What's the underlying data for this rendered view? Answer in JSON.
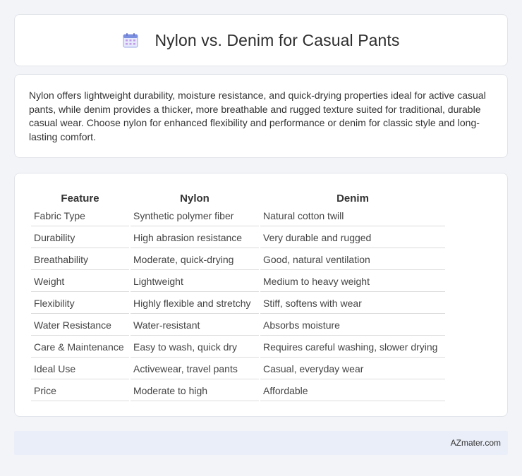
{
  "header": {
    "title": "Nylon vs. Denim for Casual Pants",
    "icon": "calendar-icon"
  },
  "summary": {
    "text": "Nylon offers lightweight durability, moisture resistance, and quick-drying properties ideal for active casual pants, while denim provides a thicker, more breathable and rugged texture suited for traditional, durable casual wear. Choose nylon for enhanced flexibility and performance or denim for classic style and long-lasting comfort."
  },
  "table": {
    "headers": [
      "Feature",
      "Nylon",
      "Denim"
    ],
    "rows": [
      [
        "Fabric Type",
        "Synthetic polymer fiber",
        "Natural cotton twill"
      ],
      [
        "Durability",
        "High abrasion resistance",
        "Very durable and rugged"
      ],
      [
        "Breathability",
        "Moderate, quick-drying",
        "Good, natural ventilation"
      ],
      [
        "Weight",
        "Lightweight",
        "Medium to heavy weight"
      ],
      [
        "Flexibility",
        "Highly flexible and stretchy",
        "Stiff, softens with wear"
      ],
      [
        "Water Resistance",
        "Water-resistant",
        "Absorbs moisture"
      ],
      [
        "Care & Maintenance",
        "Easy to wash, quick dry",
        "Requires careful washing, slower drying"
      ],
      [
        "Ideal Use",
        "Activewear, travel pants",
        "Casual, everyday wear"
      ],
      [
        "Price",
        "Moderate to high",
        "Affordable"
      ]
    ]
  },
  "footer": {
    "site": "AZmater.com"
  },
  "colors": {
    "background": "#f3f4f8",
    "card": "#ffffff",
    "footer": "#e9eef8",
    "icon_accent": "#7b8fe0"
  }
}
